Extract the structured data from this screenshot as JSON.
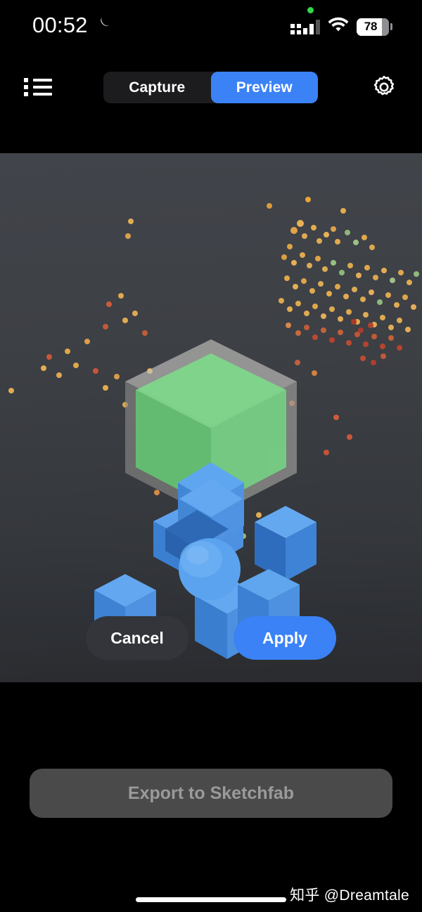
{
  "status_bar": {
    "time": "00:52",
    "dnd_icon": "crescent-moon-icon",
    "recording_dot": "green-privacy-dot",
    "signal_icon": "cellular-signal-icon",
    "wifi_icon": "wifi-icon",
    "battery_percent": "78",
    "battery_level": 78
  },
  "top_bar": {
    "menu_icon": "bulleted-list-icon",
    "settings_icon": "gear-icon",
    "segmented_control": {
      "options": [
        {
          "label": "Capture",
          "active": false
        },
        {
          "label": "Preview",
          "active": true
        }
      ],
      "selected": "Preview"
    }
  },
  "viewport": {
    "scene_name": "3d-bounding-box-editor",
    "background_top": "#41444a",
    "background_bottom": "#292b2f",
    "box_color": "#b7b7b2",
    "plane_color": "#7fd98a",
    "handle_color": "#3d8ee0",
    "sphere_color": "#3d8ee0",
    "actions": [
      {
        "label": "Cancel",
        "style": "secondary"
      },
      {
        "label": "Apply",
        "style": "primary"
      }
    ]
  },
  "footer": {
    "export_label": "Export to Sketchfab",
    "export_enabled": false,
    "watermark": "知乎 @Dreamtale",
    "home_indicator": "home-indicator-bar"
  },
  "colors": {
    "accent_blue": "#3b82f6",
    "background": "#000000",
    "segment_track": "#1c1c1e",
    "cancel_fill": "#33353a",
    "export_fill": "#4a4a4a",
    "export_text": "#9a9a9a"
  }
}
